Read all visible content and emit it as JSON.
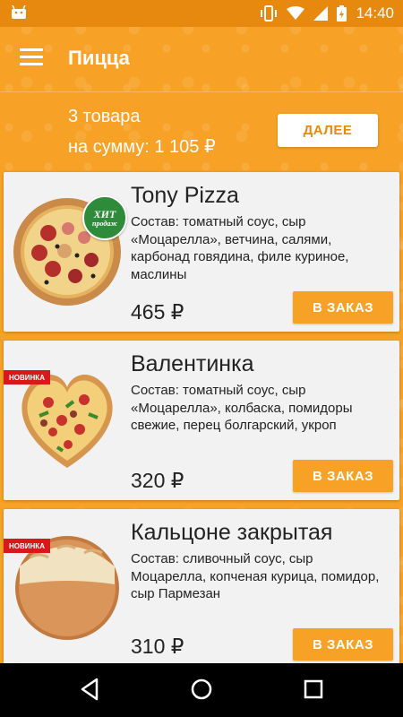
{
  "status_bar": {
    "time": "14:40"
  },
  "app_bar": {
    "title": "Пицца"
  },
  "cart": {
    "count_text": "3 товара",
    "sum_text": "на сумму: 1 105 ₽",
    "next_label": "ДАЛЕЕ"
  },
  "products": [
    {
      "name": "Tony Pizza",
      "description": "Состав: томатный соус, сыр «Моцарелла», ветчина, салями, карбонад говядина, филе куриное, маслины",
      "price": "465 ₽",
      "order_label": "В ЗАКАЗ",
      "badge_hit_line1": "ХИТ",
      "badge_hit_line2": "продаж"
    },
    {
      "name": "Валентинка",
      "description": "Состав: томатный соус, сыр «Моцарелла», колбаска, помидоры свежие, перец болгарский, укроп",
      "price": "320 ₽",
      "order_label": "В ЗАКАЗ",
      "badge_new": "НОВИНКА"
    },
    {
      "name": "Кальцоне закрытая",
      "description": "Состав: сливочный  соус, сыр Моцарелла, копченая курица, помидор, сыр Пармезан",
      "price": "310 ₽",
      "order_label": "В ЗАКАЗ",
      "badge_new": "НОВИНКА"
    }
  ],
  "colors": {
    "accent": "#f7a227",
    "status_bar": "#e8890f",
    "badge_new": "#d7191c",
    "badge_hit": "#2e8b3a"
  },
  "icons": [
    "android-icon",
    "vibrate-icon",
    "wifi-icon",
    "signal-icon",
    "battery-icon",
    "menu-icon",
    "back-icon",
    "home-icon",
    "recents-icon"
  ]
}
